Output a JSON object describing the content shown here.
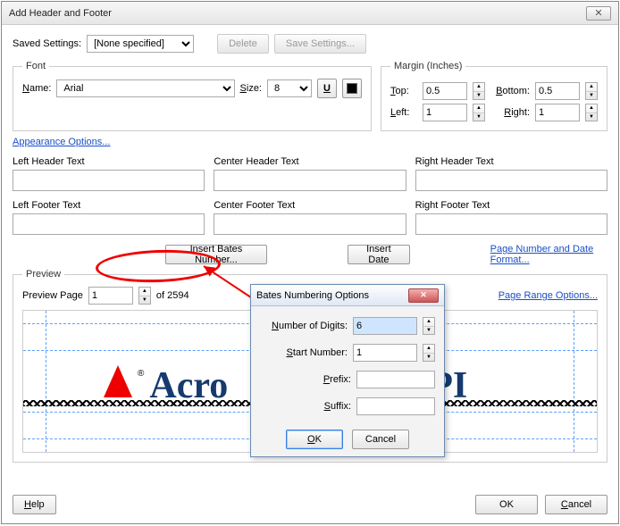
{
  "window": {
    "title": "Add Header and Footer",
    "close": "✕"
  },
  "saved": {
    "label": "Saved Settings:",
    "value": "[None specified]",
    "delete": "Delete",
    "save": "Save Settings..."
  },
  "font": {
    "legend": "Font",
    "name_label": "Name:",
    "name_value": "Arial",
    "size_label": "Size:",
    "size_value": "8",
    "underline": "U",
    "appearance_link": "Appearance Options..."
  },
  "margin": {
    "legend": "Margin (Inches)",
    "top_label": "Top:",
    "top_value": "0.5",
    "bottom_label": "Bottom:",
    "bottom_value": "0.5",
    "left_label": "Left:",
    "left_value": "1",
    "right_label": "Right:",
    "right_value": "1"
  },
  "hf": {
    "lh": "Left Header Text",
    "ch": "Center Header Text",
    "rh": "Right Header Text",
    "lf": "Left Footer Text",
    "cf": "Center Footer Text",
    "rf": "Right Footer Text",
    "lh_v": "",
    "ch_v": "",
    "rh_v": "",
    "lf_v": "",
    "cf_v": "",
    "rf_v": ""
  },
  "midrow": {
    "bates": "Insert Bates Number...",
    "date": "Insert Date",
    "format_link": "Page Number and Date Format..."
  },
  "preview": {
    "legend": "Preview",
    "page_label": "Preview Page",
    "page_value": "1",
    "total": "of 2594",
    "range_link": "Page Range Options...",
    "sample_text": "Acro",
    "sample_text2": "PI"
  },
  "footer": {
    "help": "Help",
    "ok": "OK",
    "cancel": "Cancel"
  },
  "modal": {
    "title": "Bates Numbering Options",
    "digits_label": "Number of Digits:",
    "digits_value": "6",
    "start_label": "Start Number:",
    "start_value": "1",
    "prefix_label": "Prefix:",
    "prefix_value": "",
    "suffix_label": "Suffix:",
    "suffix_value": "",
    "ok": "OK",
    "cancel": "Cancel"
  }
}
